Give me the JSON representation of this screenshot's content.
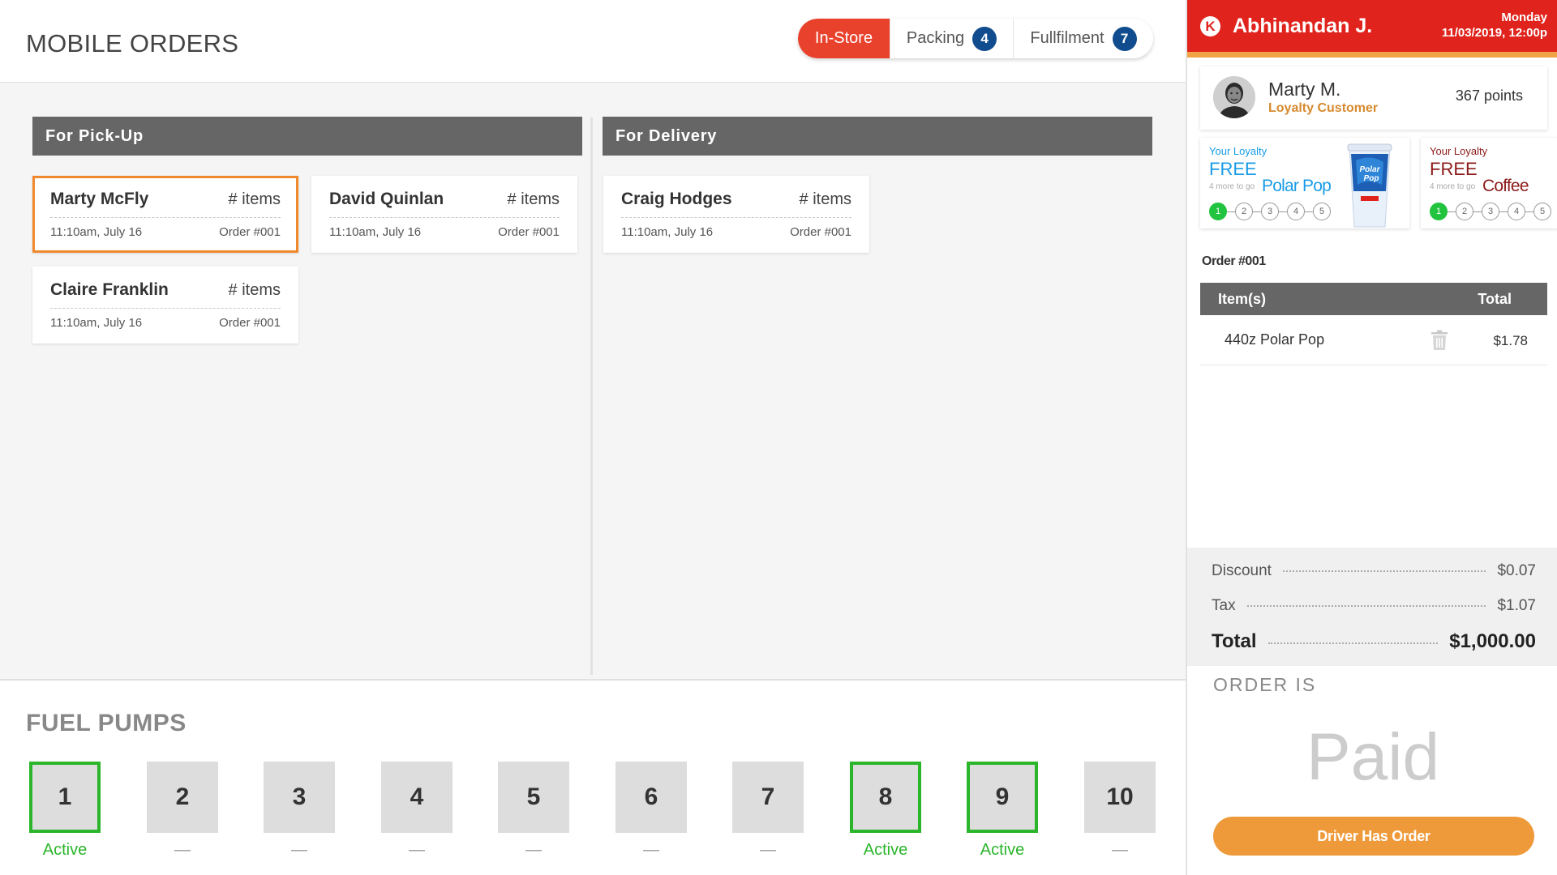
{
  "header": {
    "title": "MOBILE ORDERS",
    "tabs": [
      {
        "label": "In-Store",
        "badge": null
      },
      {
        "label": "Packing",
        "badge": "4"
      },
      {
        "label": "Fullfilment",
        "badge": "7"
      }
    ]
  },
  "pickup": {
    "title": "For Pick-Up",
    "orders": [
      {
        "name": "Marty McFly",
        "items": "# items",
        "time": "11:10am, July 16",
        "order": "Order #001"
      },
      {
        "name": "David Quinlan",
        "items": "# items",
        "time": "11:10am, July 16",
        "order": "Order #001"
      },
      {
        "name": "Claire Franklin",
        "items": "# items",
        "time": "11:10am, July 16",
        "order": "Order #001"
      }
    ]
  },
  "delivery": {
    "title": "For Delivery",
    "orders": [
      {
        "name": "Craig Hodges",
        "items": "# items",
        "time": "11:10am, July 16",
        "order": "Order #001"
      }
    ]
  },
  "fuel": {
    "title": "FUEL PUMPS",
    "pumps": [
      {
        "number": "1",
        "status": "Active",
        "active": true
      },
      {
        "number": "2",
        "status": "—",
        "active": false
      },
      {
        "number": "3",
        "status": "—",
        "active": false
      },
      {
        "number": "4",
        "status": "—",
        "active": false
      },
      {
        "number": "5",
        "status": "—",
        "active": false
      },
      {
        "number": "6",
        "status": "—",
        "active": false
      },
      {
        "number": "7",
        "status": "—",
        "active": false
      },
      {
        "number": "8",
        "status": "Active",
        "active": true
      },
      {
        "number": "9",
        "status": "Active",
        "active": true
      },
      {
        "number": "10",
        "status": "—",
        "active": false
      }
    ]
  },
  "panel": {
    "logo_letter": "K",
    "cashier": "Abhinandan J.",
    "day": "Monday",
    "datetime": "11/03/2019, 12:00p",
    "customer": {
      "name": "Marty M.",
      "type": "Loyalty Customer",
      "points": "367 points"
    },
    "loyalty": [
      {
        "label": "Your Loyalty",
        "free": "FREE",
        "more": "4 more to go",
        "product": "Polar Pop",
        "color": "#1a9be6",
        "dots": [
          "1",
          "2",
          "3",
          "4",
          "5"
        ]
      },
      {
        "label": "Your Loyalty",
        "free": "FREE",
        "more": "4 more to go",
        "product": "Coffee",
        "color": "#8c1a1a",
        "dots": [
          "1",
          "2",
          "3",
          "4",
          "5"
        ]
      }
    ],
    "order_number": "Order #001",
    "table_headers": {
      "item": "Item(s)",
      "total": "Total"
    },
    "items": [
      {
        "name": "440z Polar Pop",
        "price": "$1.78"
      }
    ],
    "summary": {
      "discount_label": "Discount",
      "discount": "$0.07",
      "tax_label": "Tax",
      "tax": "$1.07",
      "total_label": "Total",
      "total": "$1,000.00"
    },
    "order_is": "ORDER IS",
    "status": "Paid",
    "action": "Driver Has Order"
  },
  "colors": {
    "accent_red": "#e0231c",
    "tab_red": "#e8412c",
    "orange": "#ef9a3a",
    "green": "#2bb52b",
    "badge_blue": "#114c8e"
  }
}
